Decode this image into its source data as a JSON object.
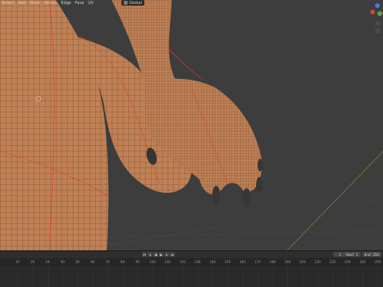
{
  "viewport": {
    "menu": [
      "Select",
      "Add",
      "Mesh",
      "Vertex",
      "Edge",
      "Face",
      "UV"
    ],
    "mode_label": "Global",
    "skin_color": "#c08055",
    "background_color": "#3d3d3d",
    "seam_color": "#e23b2b",
    "claw_color": "#2a2a2a"
  },
  "timeline": {
    "ticks": [
      "10",
      "20",
      "30",
      "40",
      "50",
      "60",
      "70",
      "80",
      "90",
      "100",
      "110",
      "120",
      "130",
      "140",
      "150",
      "160",
      "170",
      "180",
      "190",
      "200",
      "210",
      "220",
      "230",
      "240",
      "250"
    ],
    "current_frame": "1",
    "start_label": "Start",
    "start_value": "1",
    "end_label": "End",
    "end_value": "250",
    "playback_icons": [
      "jump-start-icon",
      "step-back-icon",
      "play-reverse-icon",
      "play-icon",
      "step-forward-icon",
      "jump-end-icon"
    ]
  }
}
